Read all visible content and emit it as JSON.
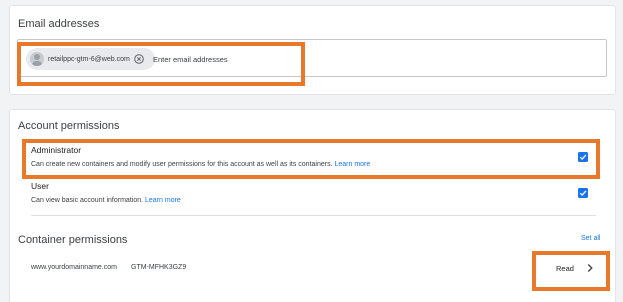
{
  "email_section": {
    "title": "Email addresses",
    "chip_email": "retailppc-gtm-6@web.com",
    "input_placeholder": "Enter email addresses"
  },
  "account_permissions": {
    "title": "Account permissions",
    "administrator": {
      "label": "Administrator",
      "description": "Can create new containers and modify user permissions for this account as well as its containers.",
      "learn_more": "Learn more",
      "checked": true
    },
    "user": {
      "label": "User",
      "description": "Can view basic account information.",
      "learn_more": "Learn more",
      "checked": true
    }
  },
  "container_permissions": {
    "title": "Container permissions",
    "set_all": "Set all",
    "rows": [
      {
        "domain": "www.yourdomainname.com",
        "container_id": "GTM-MFHK3GZ9",
        "permission": "Read"
      }
    ]
  },
  "colors": {
    "accent": "#1a73e8",
    "highlight": "#e8782a",
    "background": "#f1f3f4"
  }
}
